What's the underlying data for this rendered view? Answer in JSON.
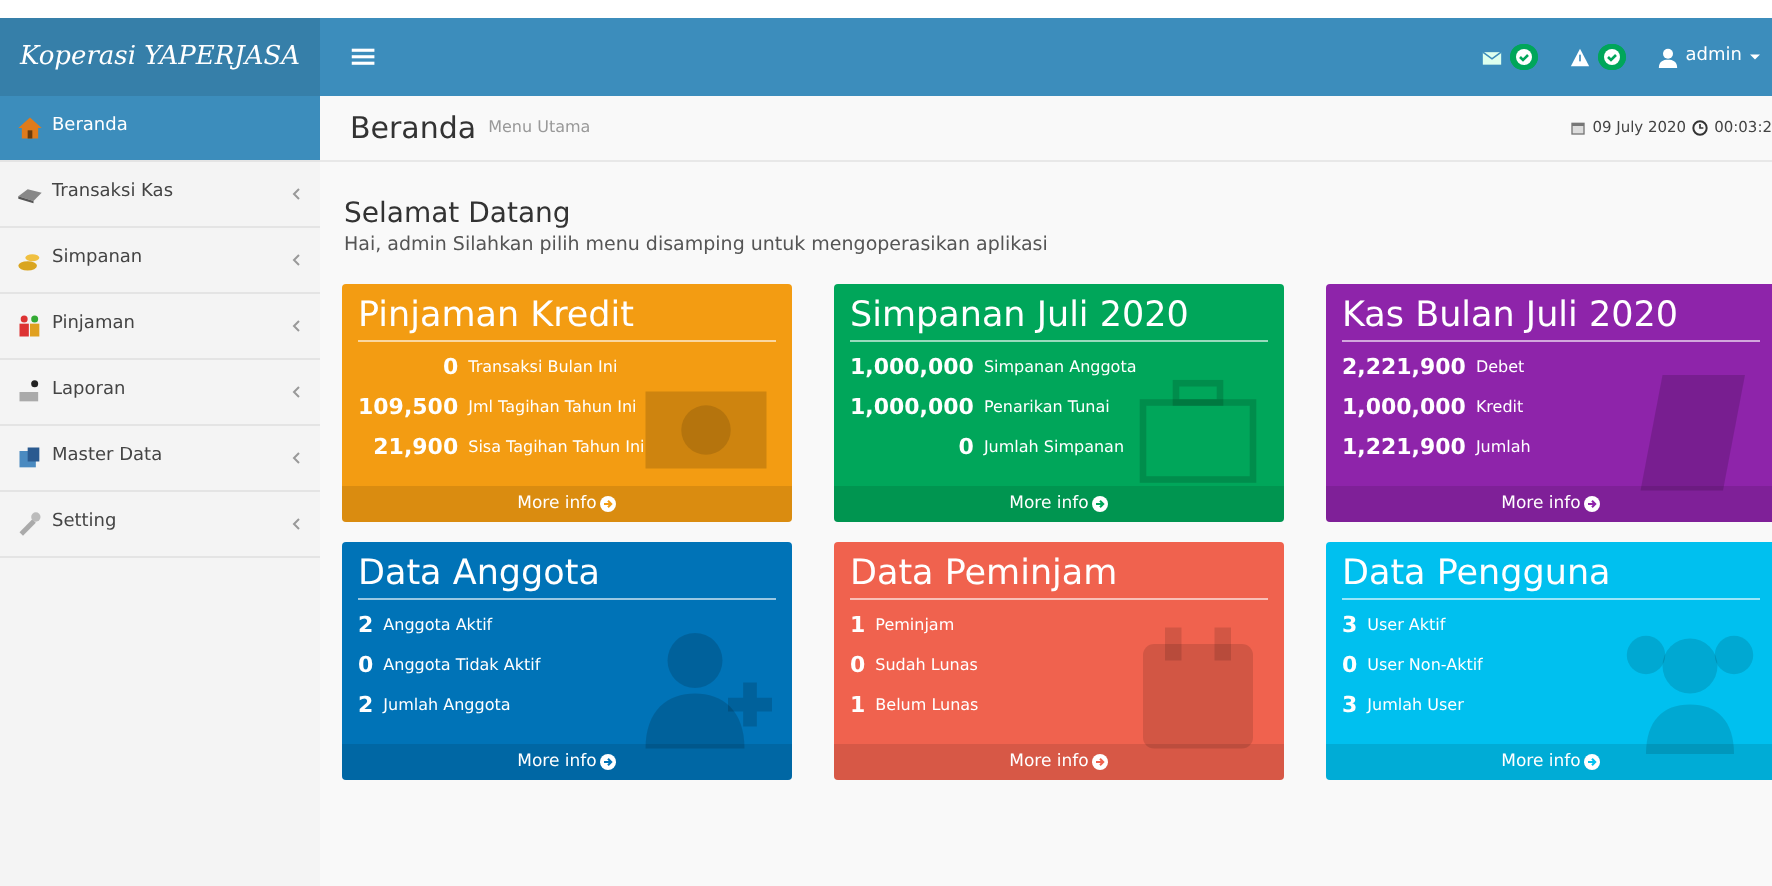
{
  "brand": "Koperasi YAPERJASA",
  "navbar": {
    "menu_glyph": "≡",
    "notifications": [
      {
        "kind": "mail"
      },
      {
        "kind": "warning"
      }
    ],
    "user": "admin"
  },
  "sidebar": {
    "items": [
      {
        "label": "Beranda",
        "selected": true,
        "has_submenu": false
      },
      {
        "label": "Transaksi Kas",
        "selected": false,
        "has_submenu": true
      },
      {
        "label": "Simpanan",
        "selected": false,
        "has_submenu": true
      },
      {
        "label": "Pinjaman",
        "selected": false,
        "has_submenu": true
      },
      {
        "label": "Laporan",
        "selected": false,
        "has_submenu": true
      },
      {
        "label": "Master Data",
        "selected": false,
        "has_submenu": true
      },
      {
        "label": "Setting",
        "selected": false,
        "has_submenu": true
      }
    ]
  },
  "content_header": {
    "title": "Beranda",
    "subtitle": "Menu Utama",
    "date": "09 July 2020",
    "time": "00:03:2"
  },
  "welcome": {
    "title": "Selamat Datang",
    "text": "Hai, admin Silahkan pilih menu disamping untuk mengoperasikan aplikasi"
  },
  "boxes": [
    {
      "title": "Pinjaman Kredit",
      "color": "#f39c12",
      "footer": "More info",
      "rows": [
        {
          "value": "0",
          "label": "Transaksi Bulan Ini"
        },
        {
          "value": "109,500",
          "label": "Jml Tagihan Tahun Ini"
        },
        {
          "value": "21,900",
          "label": "Sisa Tagihan Tahun Ini"
        }
      ]
    },
    {
      "title": "Simpanan Juli 2020",
      "color": "#00a65a",
      "footer": "More info",
      "rows": [
        {
          "value": "1,000,000",
          "label": "Simpanan Anggota"
        },
        {
          "value": "1,000,000",
          "label": "Penarikan Tunai"
        },
        {
          "value": "0",
          "label": "Jumlah Simpanan"
        }
      ]
    },
    {
      "title": "Kas Bulan Juli 2020",
      "color": "#8e24aa",
      "footer": "More info",
      "rows": [
        {
          "value": "2,221,900",
          "label": "Debet"
        },
        {
          "value": "1,000,000",
          "label": "Kredit"
        },
        {
          "value": "1,221,900",
          "label": "Jumlah"
        }
      ]
    },
    {
      "title": "Data Anggota",
      "color": "#0073b7",
      "footer": "More info",
      "rows": [
        {
          "value": "2",
          "label": "Anggota Aktif"
        },
        {
          "value": "0",
          "label": "Anggota Tidak Aktif"
        },
        {
          "value": "2",
          "label": "Jumlah Anggota"
        }
      ]
    },
    {
      "title": "Data Peminjam",
      "color": "#f0624e",
      "footer": "More info",
      "rows": [
        {
          "value": "1",
          "label": "Peminjam"
        },
        {
          "value": "0",
          "label": "Sudah Lunas"
        },
        {
          "value": "1",
          "label": "Belum Lunas"
        }
      ]
    },
    {
      "title": "Data Pengguna",
      "color": "#00c0ef",
      "footer": "More info",
      "rows": [
        {
          "value": "3",
          "label": "User Aktif"
        },
        {
          "value": "0",
          "label": "User Non-Aktif"
        },
        {
          "value": "3",
          "label": "Jumlah User"
        }
      ]
    }
  ]
}
